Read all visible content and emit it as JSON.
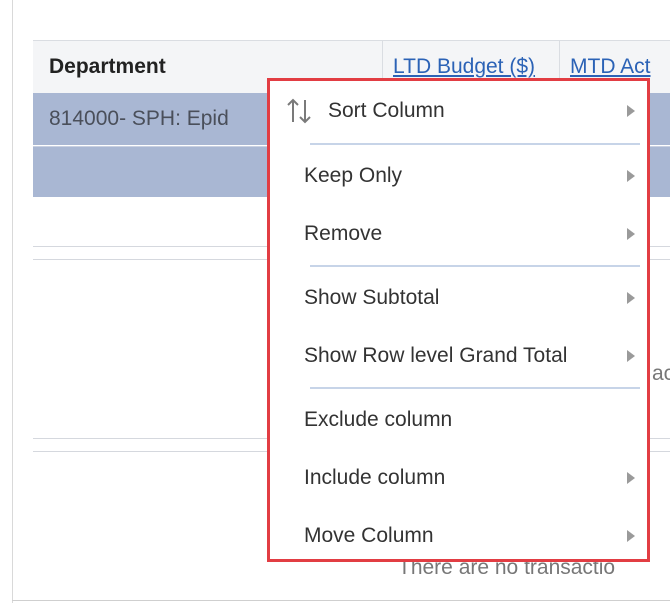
{
  "table": {
    "headers": {
      "department": "Department",
      "ltd_budget": "LTD Budget ($)",
      "mtd": "MTD Act"
    },
    "rows": [
      {
        "department": "814000- SPH: Epid"
      },
      {
        "department": ""
      }
    ]
  },
  "background_text": {
    "partial_1": "ac",
    "partial_2": "There are no transactio"
  },
  "context_menu": {
    "items": [
      {
        "label": "Sort Column",
        "has_submenu": true,
        "icon": "sort-icon"
      },
      {
        "label": "Keep Only",
        "has_submenu": true
      },
      {
        "label": "Remove",
        "has_submenu": true
      },
      {
        "label": "Show Subtotal",
        "has_submenu": true
      },
      {
        "label": "Show Row level Grand Total",
        "has_submenu": true
      },
      {
        "label": "Exclude column",
        "has_submenu": false
      },
      {
        "label": "Include column",
        "has_submenu": true
      },
      {
        "label": "Move Column",
        "has_submenu": true
      }
    ]
  },
  "colors": {
    "highlight_border": "#e23d43",
    "selected_row": "#a9b7d3",
    "link": "#2b62b6"
  }
}
